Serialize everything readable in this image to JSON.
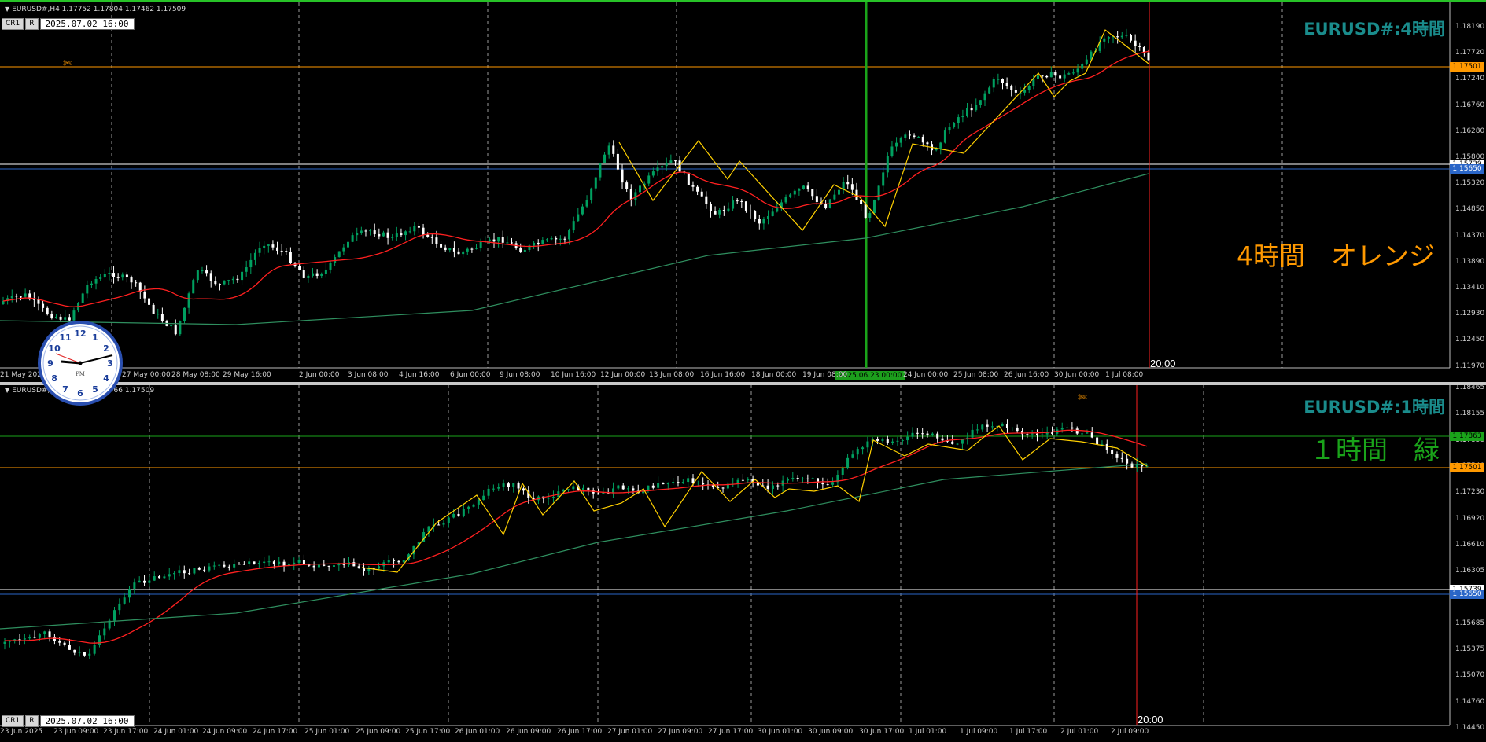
{
  "colors": {
    "bull": "#00a060",
    "bear": "#ffffff",
    "sma_short": "#ff2020",
    "sma_long": "#2f8f5f",
    "zigzag": "#ffd000",
    "orange_line": "#ff9900",
    "white_line": "#ffffff",
    "blue_line": "#2a66c8",
    "green_hline": "#1aa31a",
    "title": "#1a8c8c",
    "vline_red": "#ff2020",
    "vline_green": "#1aa31a"
  },
  "top_chart": {
    "header": "EURUSD#,H4  1.17752 1.17804 1.17462 1.17509",
    "badges": [
      "CR1",
      "R"
    ],
    "datetime": "2025.07.02 16:00",
    "title": "EURUSD#:4時間",
    "note": "4時間　オレンジ",
    "end_label": "20:00",
    "highlight_time": "2025.06.23 00:00",
    "y_ticks": [
      "1.18190",
      "1.17720",
      "1.17240",
      "1.16760",
      "1.16280",
      "1.15800",
      "1.15320",
      "1.14850",
      "1.14370",
      "1.13890",
      "1.13410",
      "1.12930",
      "1.12450",
      "1.11970"
    ],
    "price_tags": [
      {
        "text": "1.17501",
        "bg": "#ff9900",
        "fg": "#000000"
      },
      {
        "text": "1.15739",
        "bg": "#ffffff",
        "fg": "#000000"
      },
      {
        "text": "1.15650",
        "bg": "#2a66c8",
        "fg": "#ffffff"
      }
    ],
    "x_ticks": [
      "21 May 2025",
      "",
      "27 May 00:00",
      "28 May 08:00",
      "29 May 16:00",
      "2 Jun 00:00",
      "3 Jun 08:00",
      "4 Jun 16:00",
      "6 Jun 00:00",
      "9 Jun 08:00",
      "10 Jun 16:00",
      "12 Jun 00:00",
      "13 Jun 08:00",
      "16 Jun 16:00",
      "18 Jun 00:00",
      "19 Jun 08:00",
      "",
      "24 Jun 00:00",
      "25 Jun 08:00",
      "26 Jun 16:00",
      "30 Jun 00:00",
      "1 Jul 08:00"
    ]
  },
  "bottom_chart": {
    "header": "EURUSD#,H1  1.17752 1.17466 1.17509",
    "badges": [
      "CR1",
      "R"
    ],
    "datetime": "2025.07.02 16:00",
    "title": "EURUSD#:1時間",
    "note": "１時間　緑",
    "end_label": "20:00",
    "y_ticks": [
      "1.18465",
      "1.18155",
      "1.17850",
      "1.17540",
      "1.17230",
      "1.16920",
      "1.16610",
      "1.16305",
      "1.15995",
      "1.15685",
      "1.15375",
      "1.15070",
      "1.14760",
      "1.14450"
    ],
    "price_tags": [
      {
        "text": "1.17863",
        "bg": "#1aa31a",
        "fg": "#000000"
      },
      {
        "text": "1.17501",
        "bg": "#ff9900",
        "fg": "#000000"
      },
      {
        "text": "1.15739",
        "bg": "#ffffff",
        "fg": "#000000"
      },
      {
        "text": "1.15650",
        "bg": "#2a66c8",
        "fg": "#ffffff"
      }
    ],
    "x_ticks": [
      "23 Jun 2025",
      "23 Jun 09:00",
      "23 Jun 17:00",
      "24 Jun 01:00",
      "24 Jun 09:00",
      "24 Jun 17:00",
      "25 Jun 01:00",
      "25 Jun 09:00",
      "25 Jun 17:00",
      "26 Jun 01:00",
      "26 Jun 09:00",
      "26 Jun 17:00",
      "27 Jun 01:00",
      "27 Jun 09:00",
      "27 Jun 17:00",
      "30 Jun 01:00",
      "30 Jun 09:00",
      "30 Jun 17:00",
      "1 Jul 01:00",
      "1 Jul 09:00",
      "1 Jul 17:00",
      "2 Jul 01:00",
      "2 Jul 09:00"
    ]
  },
  "clock": {
    "numbers": [
      "12",
      "1",
      "2",
      "3",
      "4",
      "5",
      "6",
      "7",
      "8",
      "9",
      "10",
      "11"
    ],
    "ampm": "PM"
  }
}
